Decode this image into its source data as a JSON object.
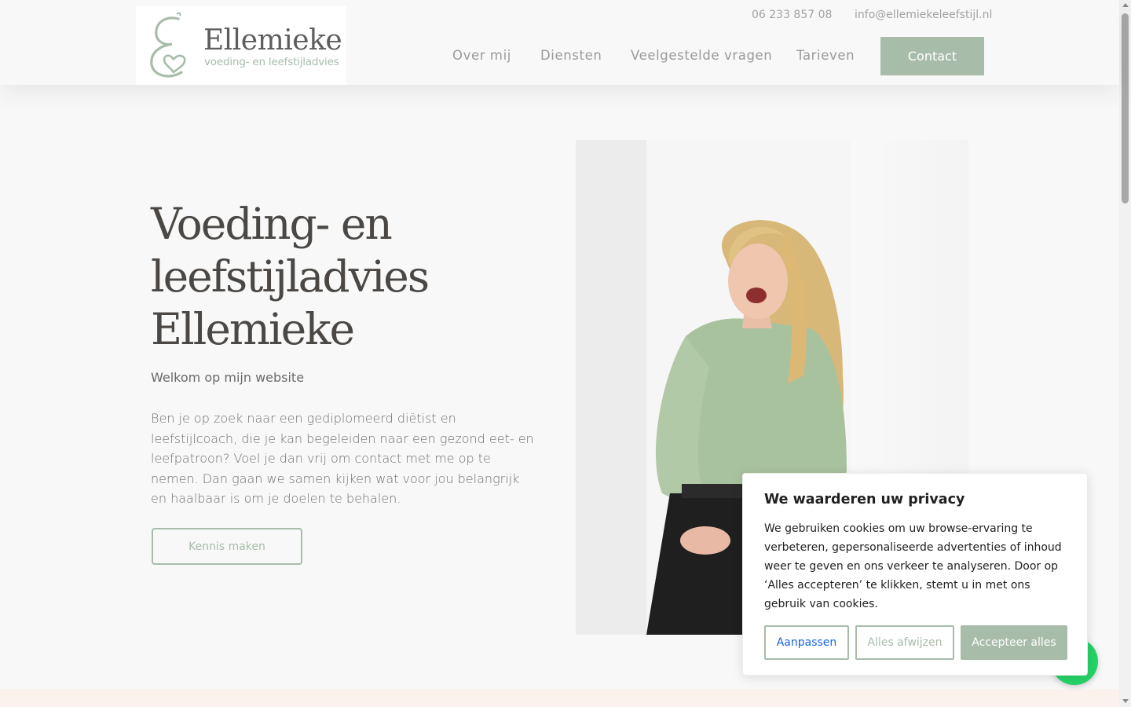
{
  "header": {
    "logo_title": "Ellemieke",
    "logo_subtitle": "voeding- en leefstijladvies",
    "phone": "06 233 857 08",
    "email": "info@ellemiekeleefstijl.nl",
    "nav": [
      "Over mij",
      "Diensten",
      "Veelgestelde vragen",
      "Tarieven"
    ],
    "contact_label": "Contact"
  },
  "hero": {
    "title": "Voeding- en leefstijladvies Ellemieke",
    "subtitle": "Welkom op mijn website",
    "text": "Ben je op zoek naar een gediplomeerd diëtist en leefstijlcoach, die je kan begeleiden naar een gezond eet- en leefpatroon? Voel je dan vrij om contact met me op te nemen. Dan gaan we samen kijken wat voor jou belangrijk en haalbaar is om je doelen te behalen.",
    "button_label": "Kennis maken"
  },
  "cookie": {
    "title": "We waarderen uw privacy",
    "text": "We gebruiken cookies om uw browse-ervaring te verbeteren, gepersonaliseerde advertenties of inhoud weer te geven en ons verkeer te analyseren. Door op ‘Alles accepteren’ te klikken, stemt u in met ons gebruik van cookies.",
    "customize_label": "Aanpassen",
    "reject_label": "Alles afwijzen",
    "accept_label": "Accepteer alles"
  },
  "colors": {
    "accent": "#a8bcaa",
    "background": "#f8f8f8",
    "link_blue": "#1863dc",
    "strip": "#fbf2ee"
  },
  "icons": {
    "logo": "ellemieke-e-heart-logo",
    "floating": "whatsapp-icon"
  }
}
